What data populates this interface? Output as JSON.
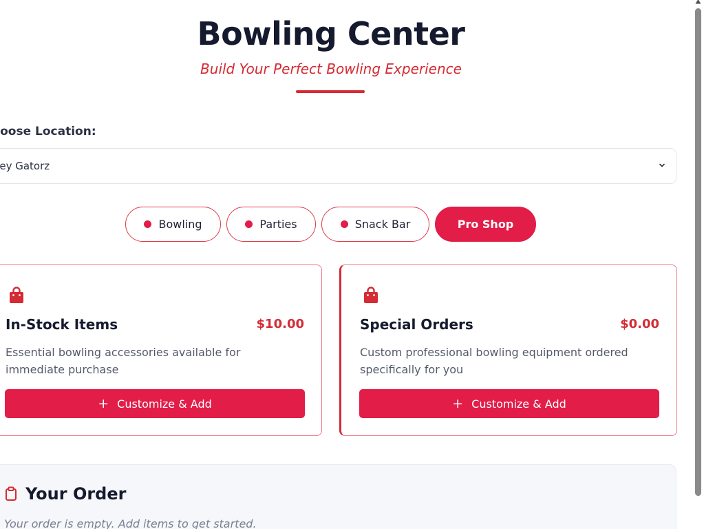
{
  "header": {
    "title": "Bowling Center",
    "subtitle": "Build Your Perfect Bowling Experience"
  },
  "location": {
    "label": "hoose Location:",
    "selected": "lley Gatorz"
  },
  "tabs": [
    {
      "label": "Bowling",
      "active": false
    },
    {
      "label": "Parties",
      "active": false
    },
    {
      "label": "Snack Bar",
      "active": false
    },
    {
      "label": "Pro Shop",
      "active": true
    }
  ],
  "cards": [
    {
      "icon": "shopping-bag-icon",
      "title": "In-Stock Items",
      "price": "$10.00",
      "description": "Essential bowling accessories available for immediate purchase",
      "button": "Customize & Add"
    },
    {
      "icon": "shopping-bag-icon",
      "title": "Special Orders",
      "price": "$0.00",
      "description": "Custom professional bowling equipment ordered specifically for you",
      "button": "Customize & Add"
    }
  ],
  "order": {
    "icon": "clipboard-icon",
    "title": "Your Order",
    "empty_message": "Your order is empty. Add items to get started."
  },
  "colors": {
    "accent": "#e11d48",
    "accent_text": "#d42b34",
    "heading": "#151a2e",
    "panel_bg": "#f5f7fa"
  }
}
